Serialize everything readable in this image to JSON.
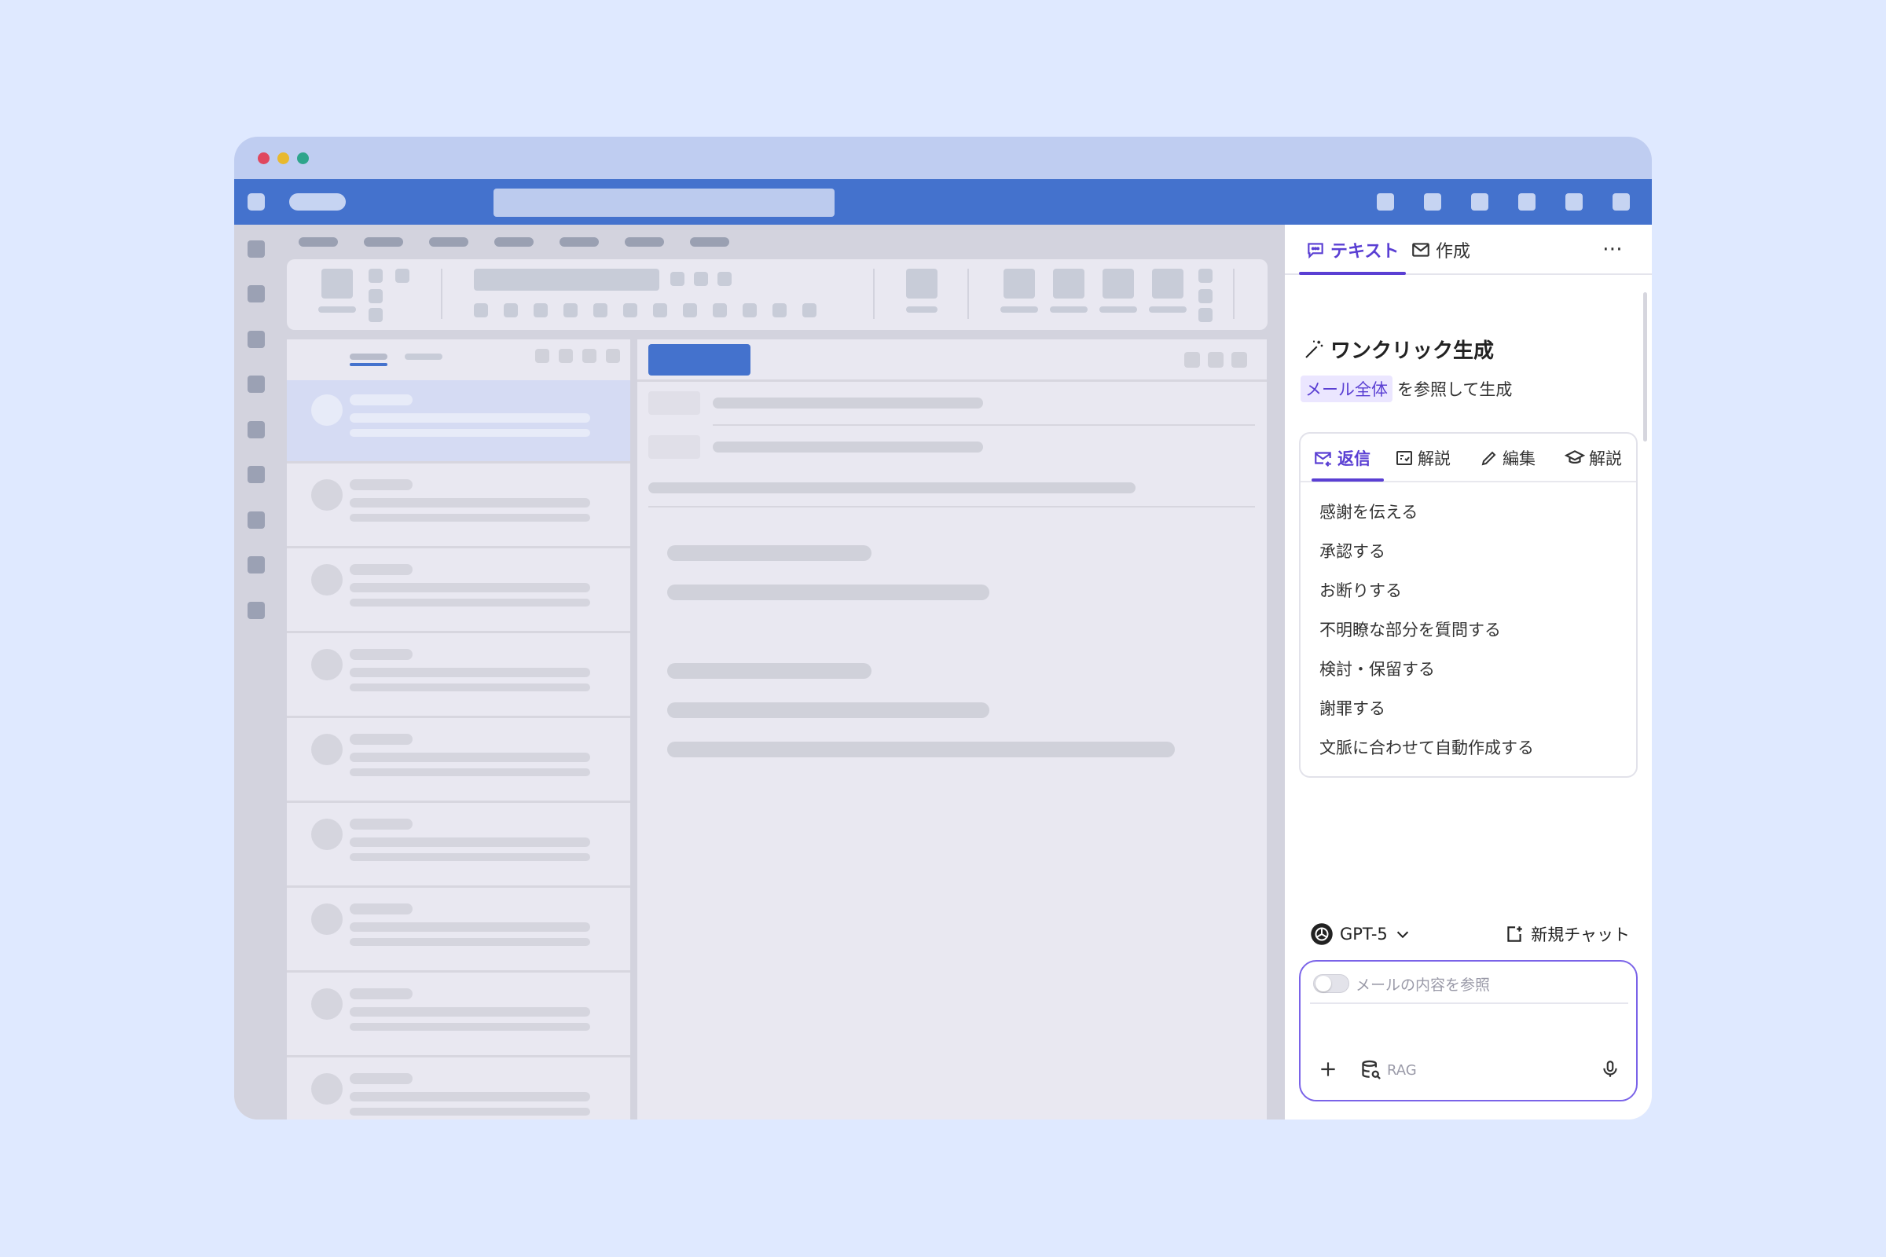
{
  "colors": {
    "background": "#dfe9ff",
    "appbar": "#4472cd",
    "accent": "#5a3fd3",
    "close": "#e0475f",
    "minimize": "#e8b92f",
    "maximize": "#2ea58c"
  },
  "sidebar_panel": {
    "tabs": [
      {
        "label": "テキスト",
        "icon": "chat-bubble-icon",
        "active": true
      },
      {
        "label": "作成",
        "icon": "envelope-icon",
        "active": false
      }
    ],
    "more_icon": "more-horizontal-icon",
    "one_click": {
      "icon": "magic-wand-icon",
      "title": "ワンクリック生成",
      "scope_chip": "メール全体",
      "scope_suffix": "を参照して生成"
    },
    "card": {
      "tabs": [
        {
          "label": "返信",
          "icon": "mail-reply-icon",
          "active": true
        },
        {
          "label": "解説",
          "icon": "explain-icon",
          "active": false
        },
        {
          "label": "編集",
          "icon": "pencil-icon",
          "active": false
        },
        {
          "label": "解説",
          "icon": "graduation-cap-icon",
          "active": false
        }
      ],
      "options": [
        "感謝を伝える",
        "承認する",
        "お断りする",
        "不明瞭な部分を質問する",
        "検討・保留する",
        "謝罪する",
        "文脈に合わせて自動作成する"
      ]
    },
    "model": {
      "name": "GPT-5",
      "icon": "openai-logo-icon"
    },
    "new_chat": "新規チャット",
    "input": {
      "toggle_on": false,
      "placeholder": "メールの内容を参照",
      "rag_label": "RAG"
    }
  }
}
